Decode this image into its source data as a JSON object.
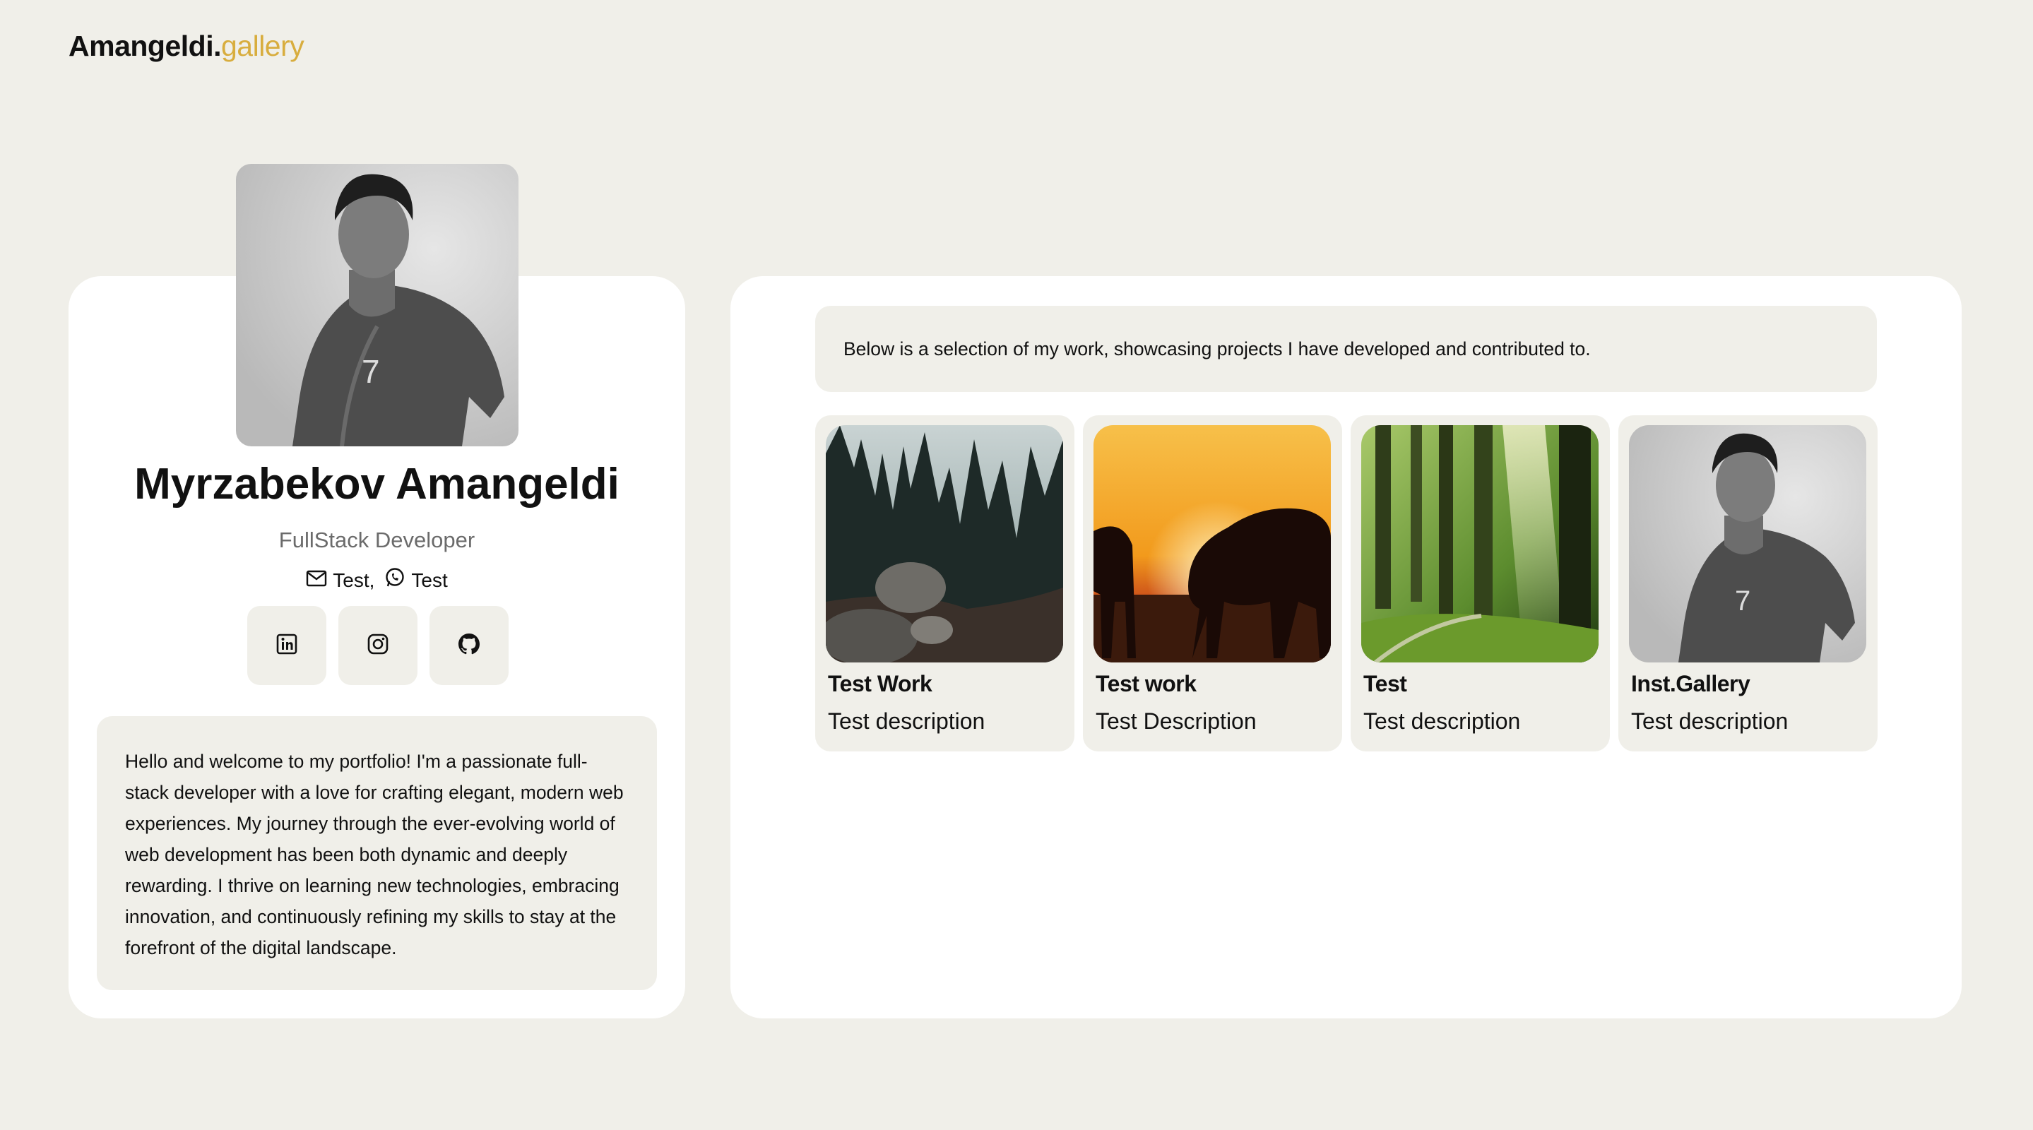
{
  "logo": {
    "name": "Amangeldi.",
    "accent": "gallery",
    "accent_color": "#d8ad3e"
  },
  "profile": {
    "name": "Myrzabekov Amangeldi",
    "role": "FullStack Developer",
    "email_label": "Test,",
    "phone_label": "Test",
    "socials": [
      {
        "icon": "linkedin-icon"
      },
      {
        "icon": "instagram-icon"
      },
      {
        "icon": "github-icon"
      }
    ],
    "about": "Hello and welcome to my portfolio! I'm a passionate full-stack developer with a love for crafting elegant, modern web experiences. My journey through the ever-evolving world of web development has been both dynamic and deeply rewarding. I thrive on learning new technologies, embracing innovation, and continuously refining my skills to stay at the forefront of the digital landscape."
  },
  "works_intro": "Below is a selection of my work, showcasing projects I have developed and contributed to.",
  "works": [
    {
      "title": "Test Work",
      "description": "Test description"
    },
    {
      "title": "Test work",
      "description": "Test Description"
    },
    {
      "title": "Test",
      "description": "Test description"
    },
    {
      "title": "Inst.Gallery",
      "description": "Test description"
    }
  ],
  "colors": {
    "background": "#f0efe9",
    "card": "#ffffff",
    "accent": "#d8ad3e"
  }
}
